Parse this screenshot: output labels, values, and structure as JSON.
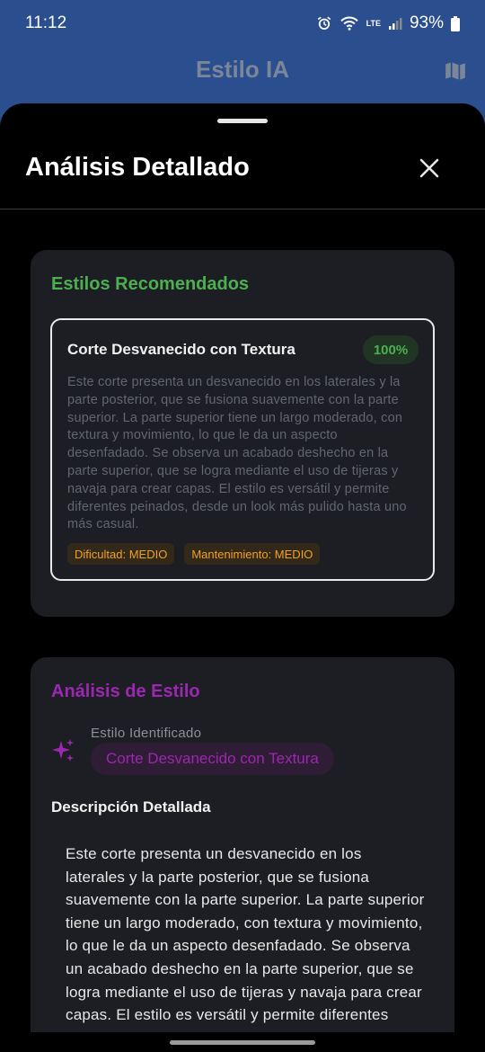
{
  "status_bar": {
    "time": "11:12",
    "battery": "93%",
    "network": "LTE"
  },
  "app_bar": {
    "title": "Estilo IA"
  },
  "sheet": {
    "title": "Análisis Detallado"
  },
  "recommended": {
    "section_title": "Estilos Recomendados",
    "items": [
      {
        "name": "Corte Desvanecido con Textura",
        "match": "100%",
        "description": "Este corte presenta un desvanecido en los laterales y la parte posterior, que se fusiona suavemente con la parte superior. La parte superior tiene un largo moderado, con textura y movimiento, lo que le da un aspecto desenfadado. Se observa un acabado deshecho en la parte superior, que se logra mediante el uso de tijeras y navaja para crear capas. El estilo es versátil y permite diferentes peinados, desde un look más pulido hasta uno más casual.",
        "difficulty": "Dificultad: MEDIO",
        "maintenance": "Mantenimiento: MEDIO"
      }
    ]
  },
  "analysis": {
    "section_title": "Análisis de Estilo",
    "identified_label": "Estilo Identificado",
    "identified_value": "Corte Desvanecido con Textura",
    "description_heading": "Descripción Detallada",
    "description": "Este corte presenta un desvanecido en los laterales y la parte posterior, que se fusiona suavemente con la parte superior. La parte superior tiene un largo moderado, con textura y movimiento, lo que le da un aspecto desenfadado. Se observa un acabado deshecho en la parte superior, que se logra mediante el uso de tijeras y navaja para crear capas. El estilo es versátil y permite diferentes peinados, desde un look más pulido hasta uno más casual."
  },
  "colors": {
    "app_bar": "#2a4e8e",
    "recommended_accent": "#4caf50",
    "analysis_accent": "#9c27b0",
    "tag_text": "#f0a028",
    "card_bg": "#1c1e23"
  },
  "icons": {
    "alarm": "alarm-icon",
    "wifi": "wifi-icon",
    "signal": "signal-icon",
    "battery": "battery-icon",
    "map": "map-icon",
    "close": "close-icon",
    "sparkle": "sparkle-icon"
  }
}
